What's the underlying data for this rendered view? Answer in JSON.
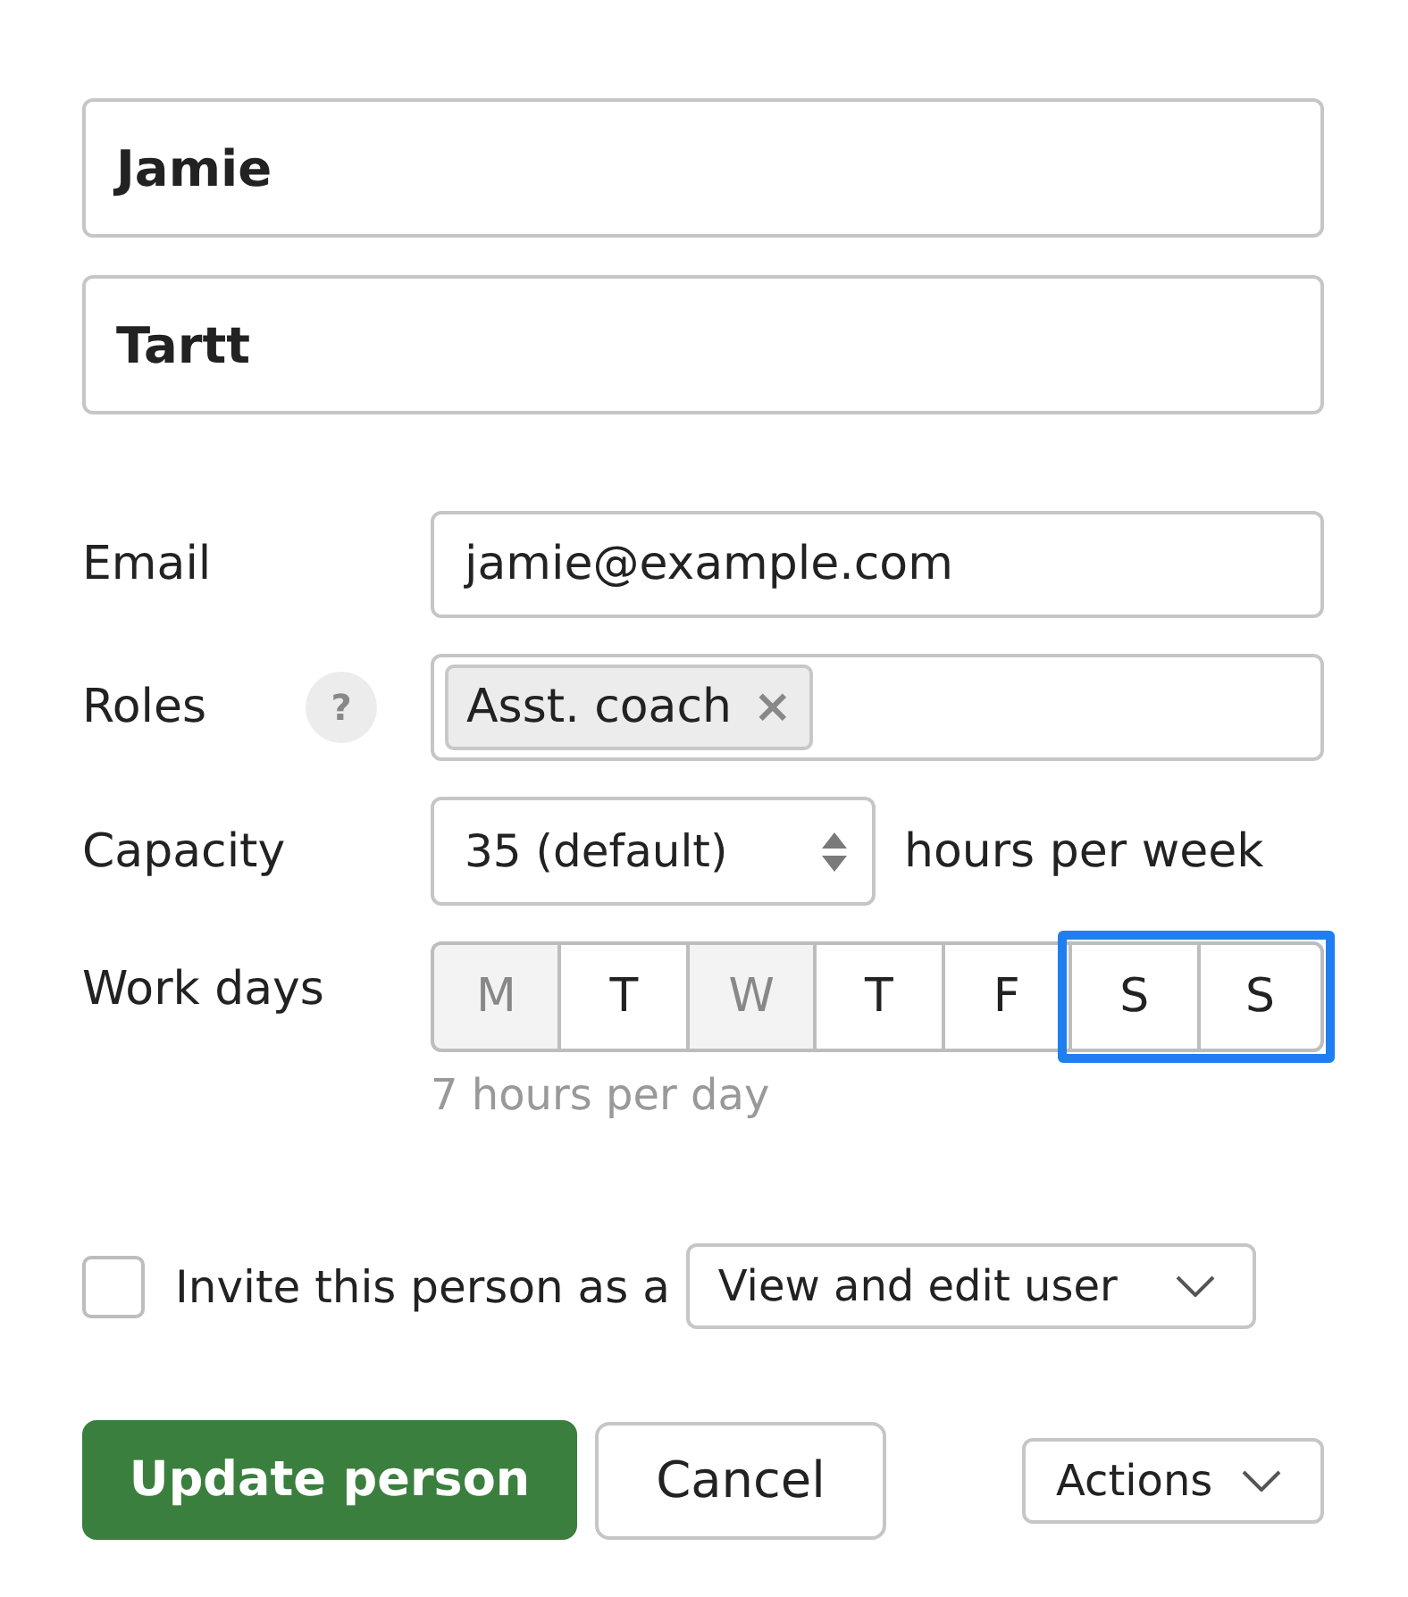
{
  "first_name": {
    "value": "Jamie"
  },
  "last_name": {
    "value": "Tartt"
  },
  "email": {
    "label": "Email",
    "value": "jamie@example.com"
  },
  "roles": {
    "label": "Roles",
    "help": "?",
    "tags": [
      {
        "label": "Asst. coach",
        "remove": "×"
      }
    ]
  },
  "capacity": {
    "label": "Capacity",
    "value": "35 (default)",
    "unit": "hours per week"
  },
  "work_days": {
    "label": "Work days",
    "days": [
      {
        "label": "M",
        "on": false,
        "focused": false
      },
      {
        "label": "T",
        "on": true,
        "focused": false
      },
      {
        "label": "W",
        "on": false,
        "focused": false
      },
      {
        "label": "T",
        "on": true,
        "focused": false
      },
      {
        "label": "F",
        "on": true,
        "focused": false
      },
      {
        "label": "S",
        "on": true,
        "focused": true
      },
      {
        "label": "S",
        "on": true,
        "focused": true
      }
    ],
    "hint": "7 hours per day"
  },
  "invite": {
    "checked": false,
    "label": "Invite this person as a",
    "role": "View and edit user"
  },
  "buttons": [
    {
      "kind": "primary",
      "label": "Update person"
    },
    {
      "kind": "secondary",
      "label": "Cancel"
    },
    {
      "kind": "menu",
      "label": "Actions"
    }
  ]
}
